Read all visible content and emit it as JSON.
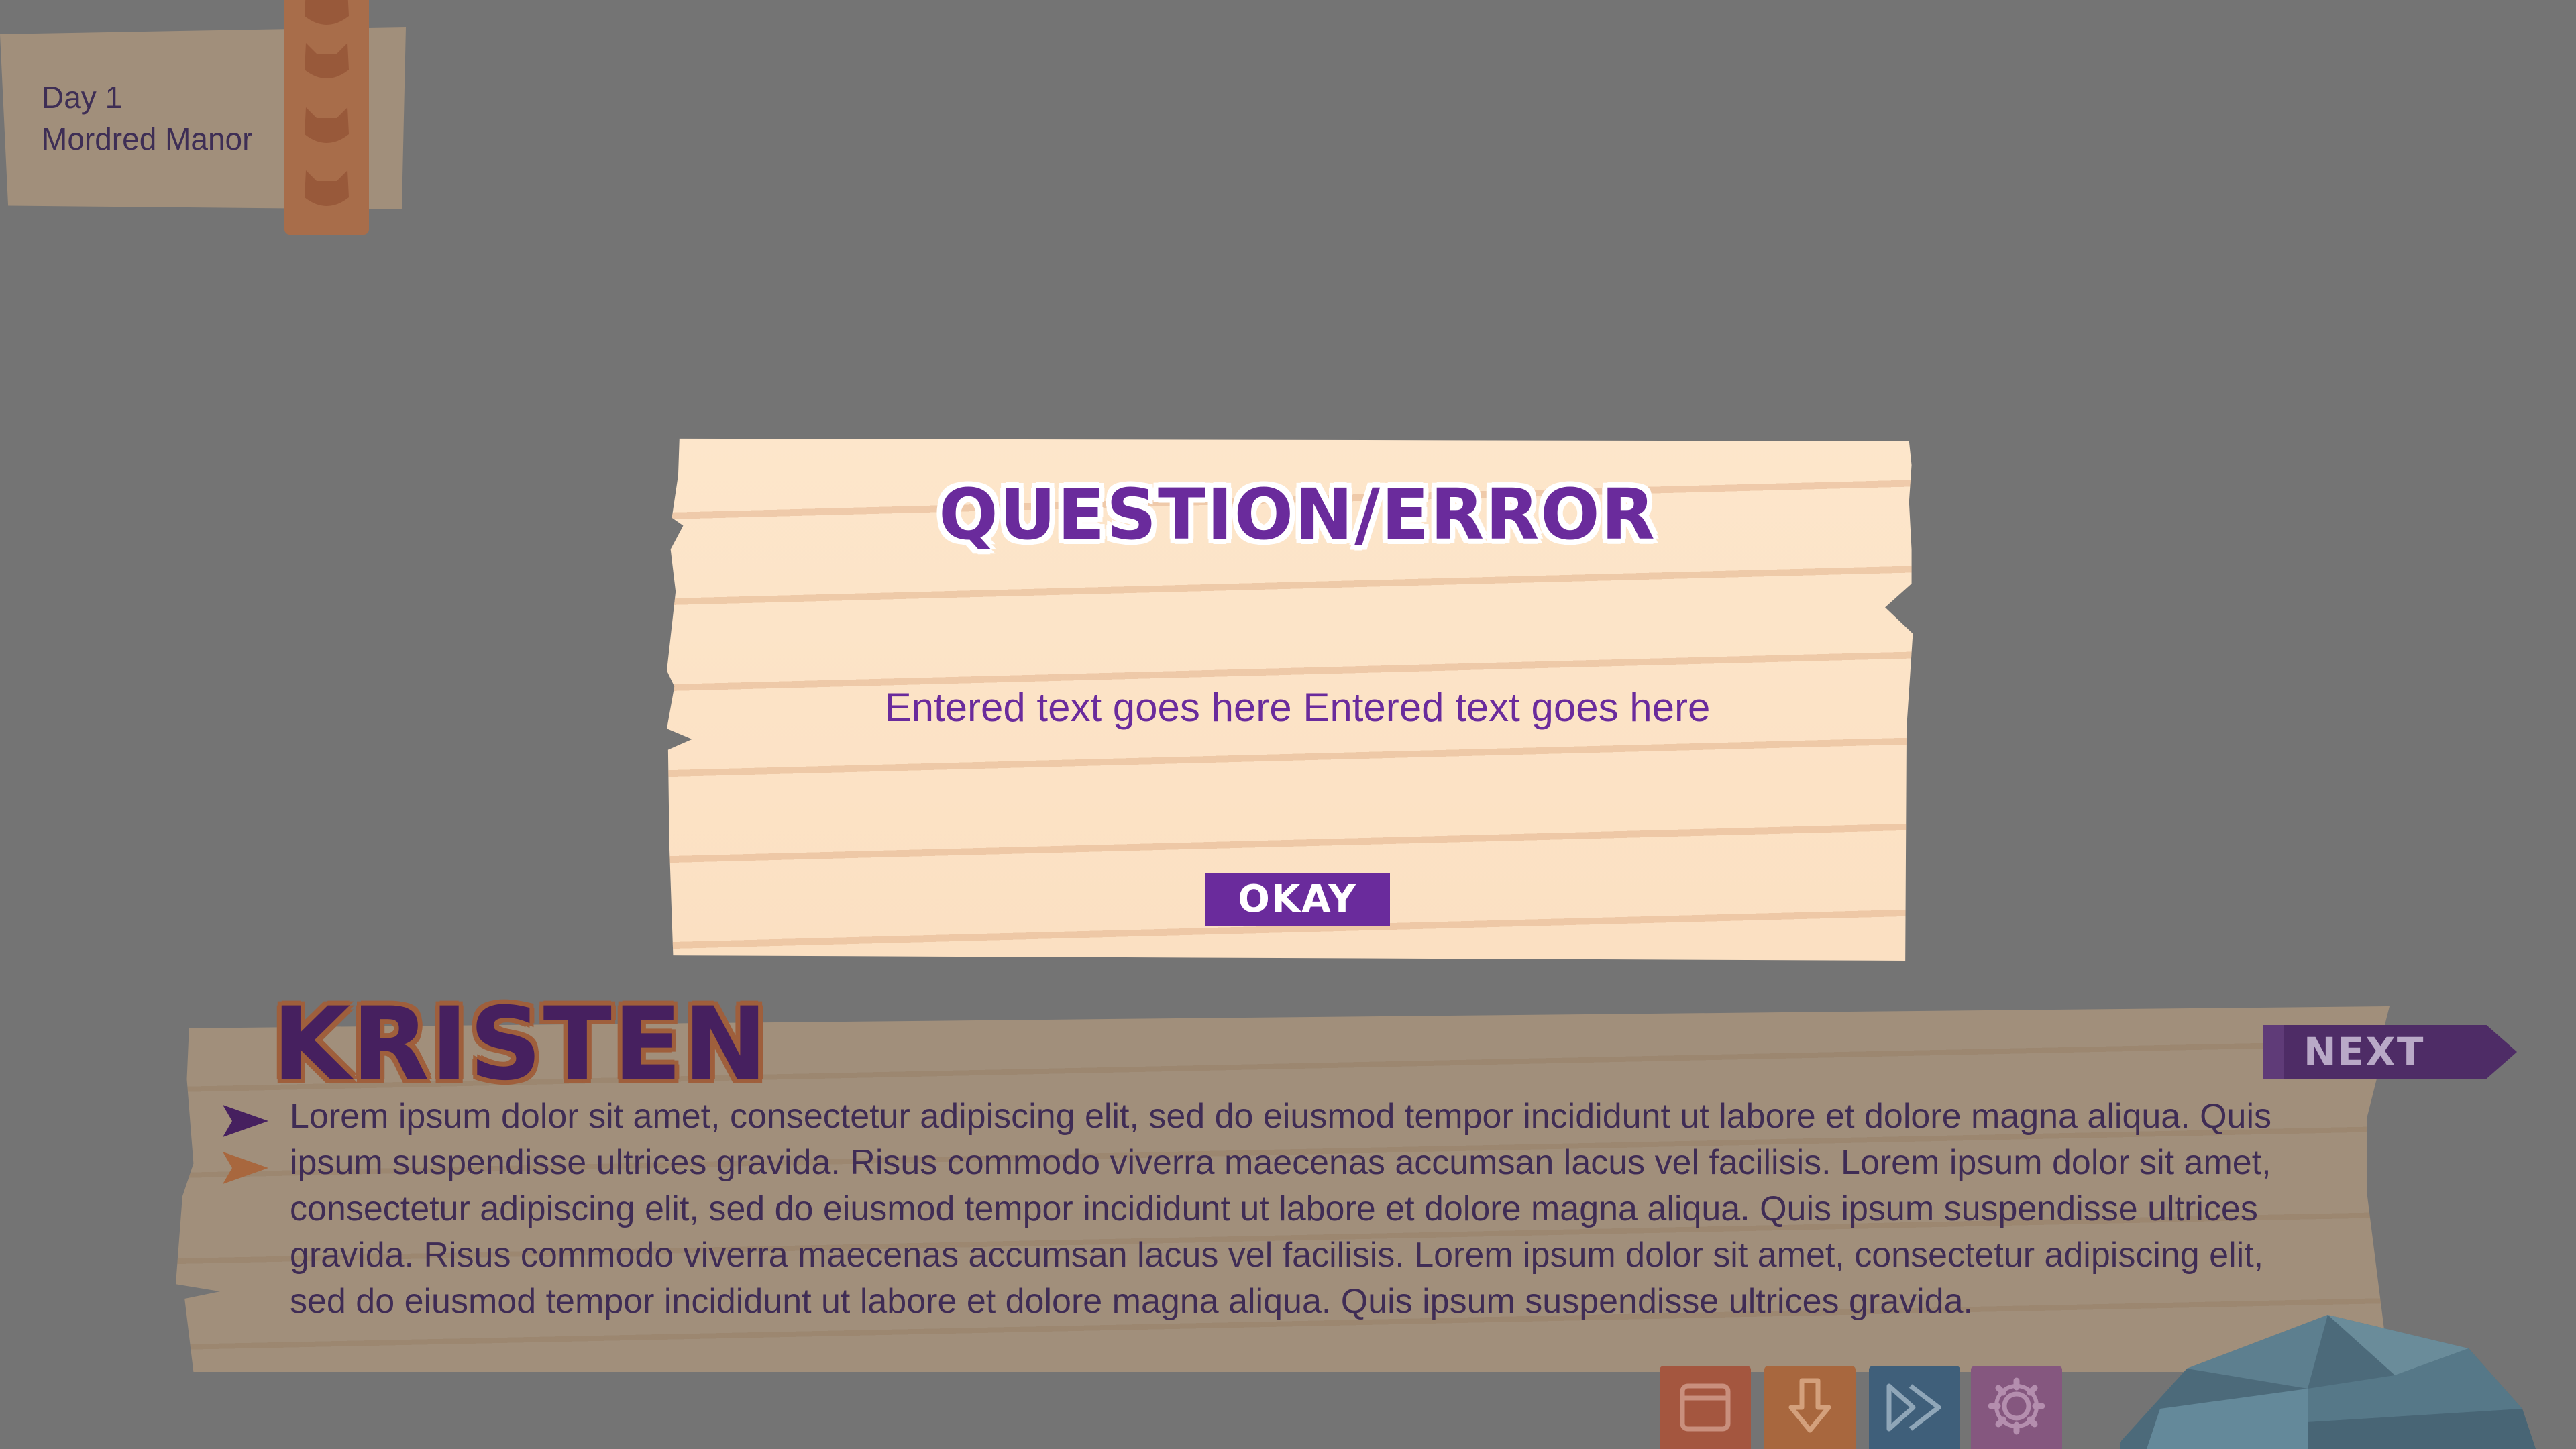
{
  "location": {
    "day": "Day 1",
    "place": "Mordred Manor"
  },
  "dialog": {
    "title": "QUESTION/ERROR",
    "message": "Entered text goes here Entered text goes here",
    "okay_label": "OKAY"
  },
  "dialogue": {
    "speaker": "KRISTEN",
    "next_label": "NEXT",
    "text": "Lorem ipsum dolor sit amet, consectetur adipiscing elit, sed do eiusmod tempor incididunt ut labore et dolore magna aliqua. Quis ipsum suspendisse ultrices gravida. Risus commodo viverra maecenas accumsan lacus vel facilisis. Lorem ipsum dolor sit amet, consectetur adipiscing elit, sed do eiusmod tempor incididunt ut labore et dolore magna aliqua. Quis ipsum suspendisse ultrices gravida. Risus commodo viverra maecenas accumsan lacus vel facilisis. Lorem ipsum dolor sit amet, consectetur adipiscing elit, sed do eiusmod tempor incididunt ut labore et dolore magna aliqua. Quis ipsum suspendisse ultrices gravida."
  },
  "quick_menu": [
    {
      "icon": "window-icon",
      "color": "#a4563f"
    },
    {
      "icon": "download-arrow-icon",
      "color": "#a8673e"
    },
    {
      "icon": "fast-forward-icon",
      "color": "#3f5f7a"
    },
    {
      "icon": "gear-icon",
      "color": "#85577f"
    }
  ],
  "colors": {
    "overlay": "#747474",
    "accent_purple": "#6a2b9c",
    "parchment": "#fbe0c2",
    "dim_panel": "#a18f7b",
    "speaker_outline": "#9f5f3c"
  }
}
